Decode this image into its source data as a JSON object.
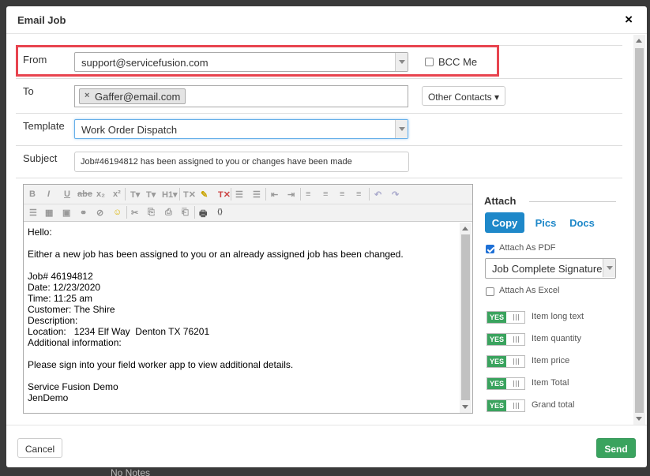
{
  "background": {
    "text": "No Notes"
  },
  "modal": {
    "title": "Email Job",
    "close_label": "×"
  },
  "from": {
    "label": "From",
    "value": "support@servicefusion.com",
    "bcc_label": "BCC Me",
    "bcc_checked": false
  },
  "to": {
    "label": "To",
    "recipients": [
      "Gaffer@email.com"
    ],
    "other_contacts_label": "Other Contacts ▾"
  },
  "template": {
    "label": "Template",
    "value": "Work Order Dispatch"
  },
  "subject": {
    "label": "Subject",
    "value": "Job#46194812 has been assigned to you or changes have been made"
  },
  "editor": {
    "toolbar_row1": [
      "B",
      "I",
      "U",
      "abe",
      "x₂",
      "x²",
      "T▾",
      "T▾",
      "H1▾",
      "T✕",
      "✎",
      "T✕",
      "☰",
      "☰",
      "⇤",
      "⇥",
      "≡",
      "≡",
      "≡",
      "≡",
      "↶",
      "↷"
    ],
    "toolbar_row2": [
      "☰",
      "▦",
      "▣",
      "⚭",
      "⊘",
      "☺",
      "✂",
      "⎘",
      "⎙",
      "⎗",
      "🖶",
      "⟨⟩"
    ],
    "lines": [
      "Hello:",
      "",
      "Either a new job has been assigned to you or an already assigned job has been changed.",
      "",
      "Job# 46194812",
      "Date: 12/23/2020",
      "Time: 11:25 am",
      "Customer: The Shire",
      "Description:",
      "Location:   1234 Elf Way  Denton TX 76201",
      "Additional information:",
      "",
      "Please sign into your field worker app to view additional details.",
      "",
      "Service Fusion Demo",
      "JenDemo"
    ]
  },
  "attach": {
    "title": "Attach",
    "tabs": [
      "Copy",
      "Pics",
      "Docs"
    ],
    "active_tab": "Copy",
    "attach_pdf_label": "Attach As PDF",
    "attach_pdf_checked": true,
    "pdf_template": "Job Complete Signature",
    "attach_excel_label": "Attach As Excel",
    "attach_excel_checked": false,
    "toggle_on_label": "YES",
    "toggles": [
      {
        "label": "Item long text",
        "on": true
      },
      {
        "label": "Item quantity",
        "on": true
      },
      {
        "label": "Item price",
        "on": true
      },
      {
        "label": "Item Total",
        "on": true
      },
      {
        "label": "Grand total",
        "on": true
      }
    ]
  },
  "footer": {
    "cancel_label": "Cancel",
    "send_label": "Send"
  },
  "colors": {
    "accent_blue": "#1e88c9",
    "send_green": "#3aa35e",
    "toggle_green": "#3aa35e",
    "highlight_red": "#e8444f"
  }
}
